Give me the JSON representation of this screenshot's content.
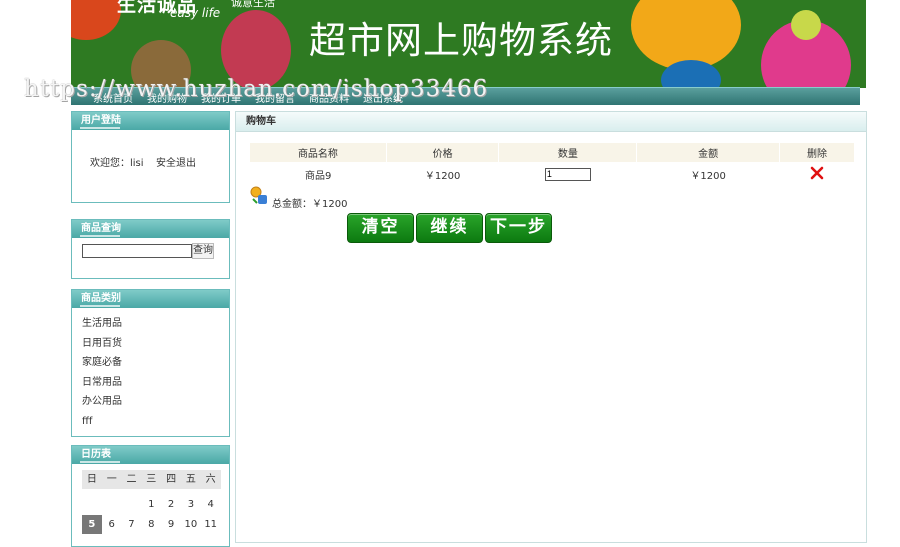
{
  "banner": {
    "logo_text": "生活诚品",
    "logo_sub": "诚意生活",
    "logo_en": "easy life",
    "title": "超市网上购物系统"
  },
  "nav": {
    "items": [
      "系统首页",
      "我的购物",
      "我的订单",
      "我的留言",
      "商品资料",
      "退出系统"
    ]
  },
  "watermark": "https://www.huzhan.com/ishop33466",
  "login_panel": {
    "title": "用户登陆",
    "welcome": "欢迎您：lisi",
    "logout": "安全退出"
  },
  "search_panel": {
    "title": "商品查询",
    "input_value": "",
    "button": "查询"
  },
  "category_panel": {
    "title": "商品类别",
    "items": [
      "生活用品",
      "日用百货",
      "家庭必备",
      "日常用品",
      "办公用品",
      "fff"
    ]
  },
  "calendar_panel": {
    "title": "日历表",
    "weekdays": [
      "日",
      "一",
      "二",
      "三",
      "四",
      "五",
      "六"
    ],
    "week1": [
      "",
      "",
      "",
      "1",
      "2",
      "3",
      "4"
    ],
    "week2": [
      "5",
      "6",
      "7",
      "8",
      "9",
      "10",
      "11"
    ],
    "today": "5"
  },
  "cart": {
    "title": "购物车",
    "headers": [
      "商品名称",
      "价格",
      "数量",
      "金额",
      "删除"
    ],
    "rows": [
      {
        "name": "商品9",
        "price": "￥1200",
        "qty": "1",
        "amount": "￥1200"
      }
    ],
    "total_label": "总金额：￥1200",
    "buttons": [
      "清空",
      "继续",
      "下一步"
    ]
  },
  "colors": {
    "panel_head": "#4aa8a6",
    "button_green": "#0c7a10",
    "banner_green": "#2e7a22"
  }
}
